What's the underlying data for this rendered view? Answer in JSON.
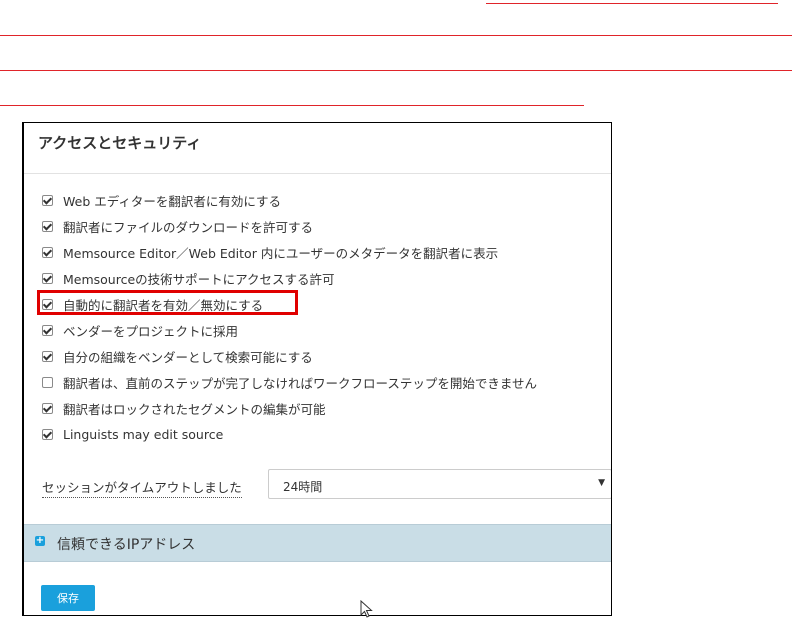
{
  "panel": {
    "title": "アクセスとセキュリティ"
  },
  "options": [
    {
      "label": "Web エディターを翻訳者に有効にする",
      "checked": true
    },
    {
      "label": "翻訳者にファイルのダウンロードを許可する",
      "checked": true
    },
    {
      "label": "Memsource Editor／Web Editor 内にユーザーのメタデータを翻訳者に表示",
      "checked": true
    },
    {
      "label": "Memsourceの技術サポートにアクセスする許可",
      "checked": true
    },
    {
      "label": "自動的に翻訳者を有効／無効にする",
      "checked": true
    },
    {
      "label": "ベンダーをプロジェクトに採用",
      "checked": true
    },
    {
      "label": "自分の組織をベンダーとして検索可能にする",
      "checked": true
    },
    {
      "label": "翻訳者は、直前のステップが完了しなければワークフローステップを開始できません",
      "checked": false
    },
    {
      "label": "翻訳者はロックされたセグメントの編集が可能",
      "checked": true
    },
    {
      "label": "Linguists may edit source",
      "checked": true
    }
  ],
  "session": {
    "label": "セッションがタイムアウトしました",
    "value": "24時間"
  },
  "ip_section": {
    "label": "信頼できるIPアドレス"
  },
  "save_label": "保存",
  "colors": {
    "accent": "#1aa0dc",
    "highlight": "#e00000",
    "section_bg": "#c9dde6"
  }
}
